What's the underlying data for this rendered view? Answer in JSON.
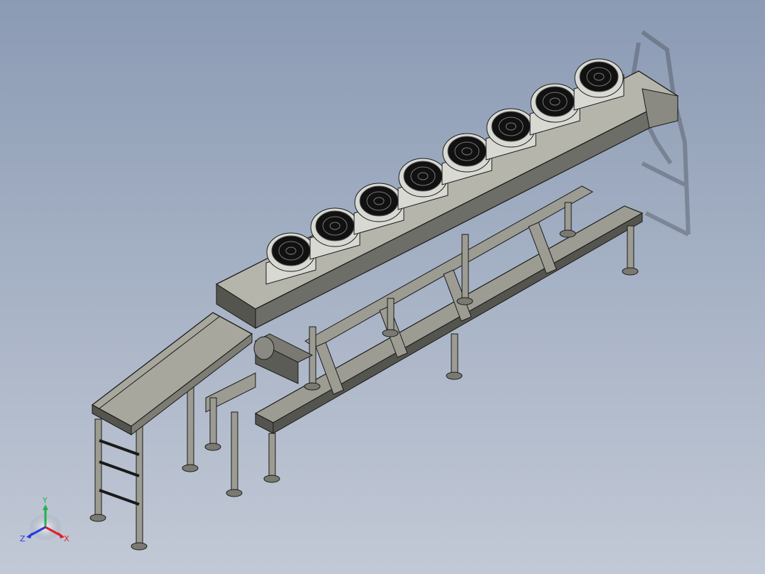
{
  "viewport": {
    "background_top": "#8b9bb4",
    "background_bottom": "#c2c9d6"
  },
  "model": {
    "fan_count": 8,
    "frame_color": "#9c9c92",
    "frame_dark": "#55554f",
    "panel_color": "#6e6e68",
    "edge_color": "#1a1a1a",
    "fan_body": "#d9d9d4",
    "fan_grill": "#111111"
  },
  "triad": {
    "x_label": "X",
    "y_label": "Y",
    "z_label": "Z",
    "x_color": "#e0202a",
    "y_color": "#22b14c",
    "z_color": "#2a3adf"
  }
}
